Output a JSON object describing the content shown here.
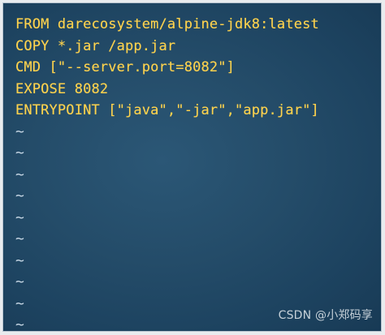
{
  "editor": {
    "lines": [
      "FROM darecosystem/alpine-jdk8:latest",
      "COPY *.jar /app.jar",
      "CMD [\"--server.port=8082\"]",
      "EXPOSE 8082",
      "ENTRYPOINT [\"java\",\"-jar\",\"app.jar\"]"
    ],
    "empty_line_marker": "~",
    "empty_lines_count": 10,
    "colors": {
      "background": "#244c69",
      "text": "#ffd34d",
      "tilde": "#d8e6f2"
    }
  },
  "watermark": {
    "text": "CSDN @小郑码享"
  }
}
